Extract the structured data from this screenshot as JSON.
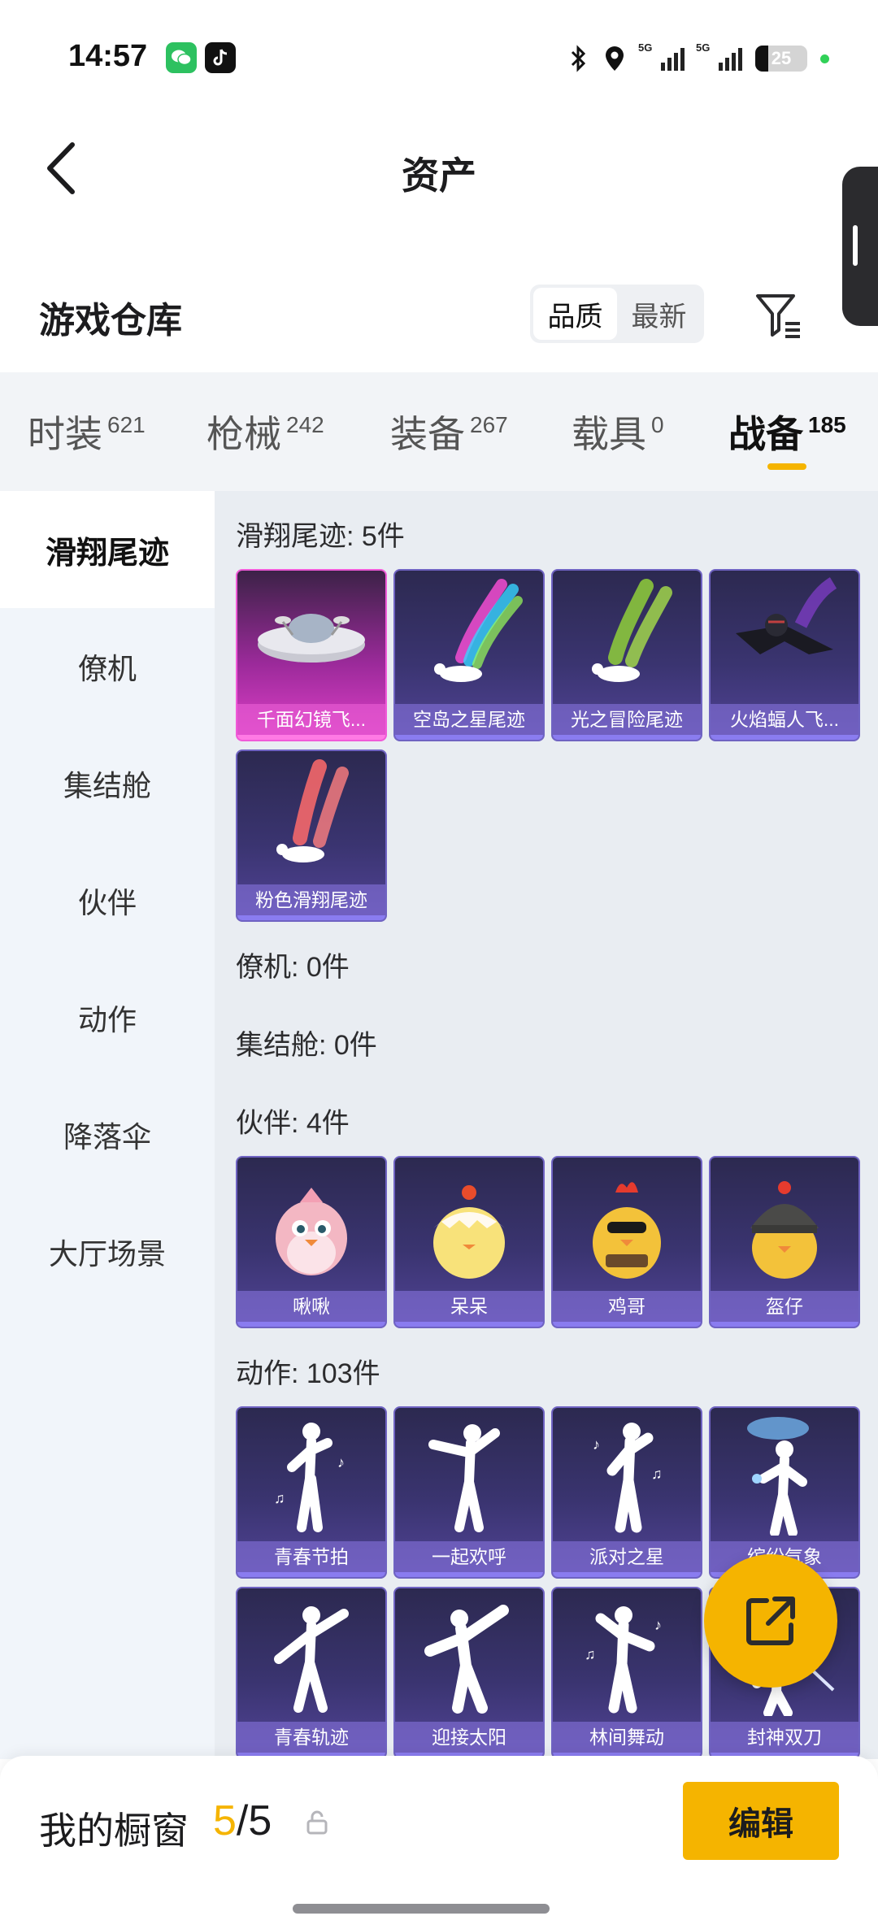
{
  "status_bar": {
    "time": "14:57",
    "battery": "25",
    "net1": "5G",
    "net2": "5G"
  },
  "header": {
    "title": "资产"
  },
  "warehouse": {
    "title": "游戏仓库",
    "sort_options": [
      "品质",
      "最新"
    ],
    "active_sort": "品质"
  },
  "tabs": [
    {
      "label": "时装",
      "count": "621"
    },
    {
      "label": "枪械",
      "count": "242"
    },
    {
      "label": "装备",
      "count": "267"
    },
    {
      "label": "载具",
      "count": "0"
    },
    {
      "label": "战备",
      "count": "185"
    }
  ],
  "active_tab": "战备",
  "sidebar": {
    "items": [
      "滑翔尾迹",
      "僚机",
      "集结舱",
      "伙伴",
      "动作",
      "降落伞",
      "大厅场景"
    ],
    "active": "滑翔尾迹"
  },
  "sections": {
    "glide": {
      "title": "滑翔尾迹: 5件",
      "items": [
        "千面幻镜飞...",
        "空岛之星尾迹",
        "光之冒险尾迹",
        "火焰蝠人飞...",
        "粉色滑翔尾迹"
      ]
    },
    "wingman": {
      "title": "僚机: 0件"
    },
    "pod": {
      "title": "集结舱: 0件"
    },
    "partner": {
      "title": "伙伴: 4件",
      "items": [
        "啾啾",
        "呆呆",
        "鸡哥",
        "盔仔"
      ]
    },
    "emote": {
      "title": "动作: 103件",
      "items": [
        "青春节拍",
        "一起欢呼",
        "派对之星",
        "缤纷气象",
        "青春轨迹",
        "迎接太阳",
        "林间舞动",
        "封神双刀"
      ]
    }
  },
  "bottom": {
    "label": "我的橱窗",
    "current": "5",
    "separator": "/",
    "total": "5",
    "edit_label": "编辑"
  },
  "colors": {
    "accent": "#f5b400",
    "card_bg": "#3a3470",
    "card_highlight": "#e040c8"
  }
}
